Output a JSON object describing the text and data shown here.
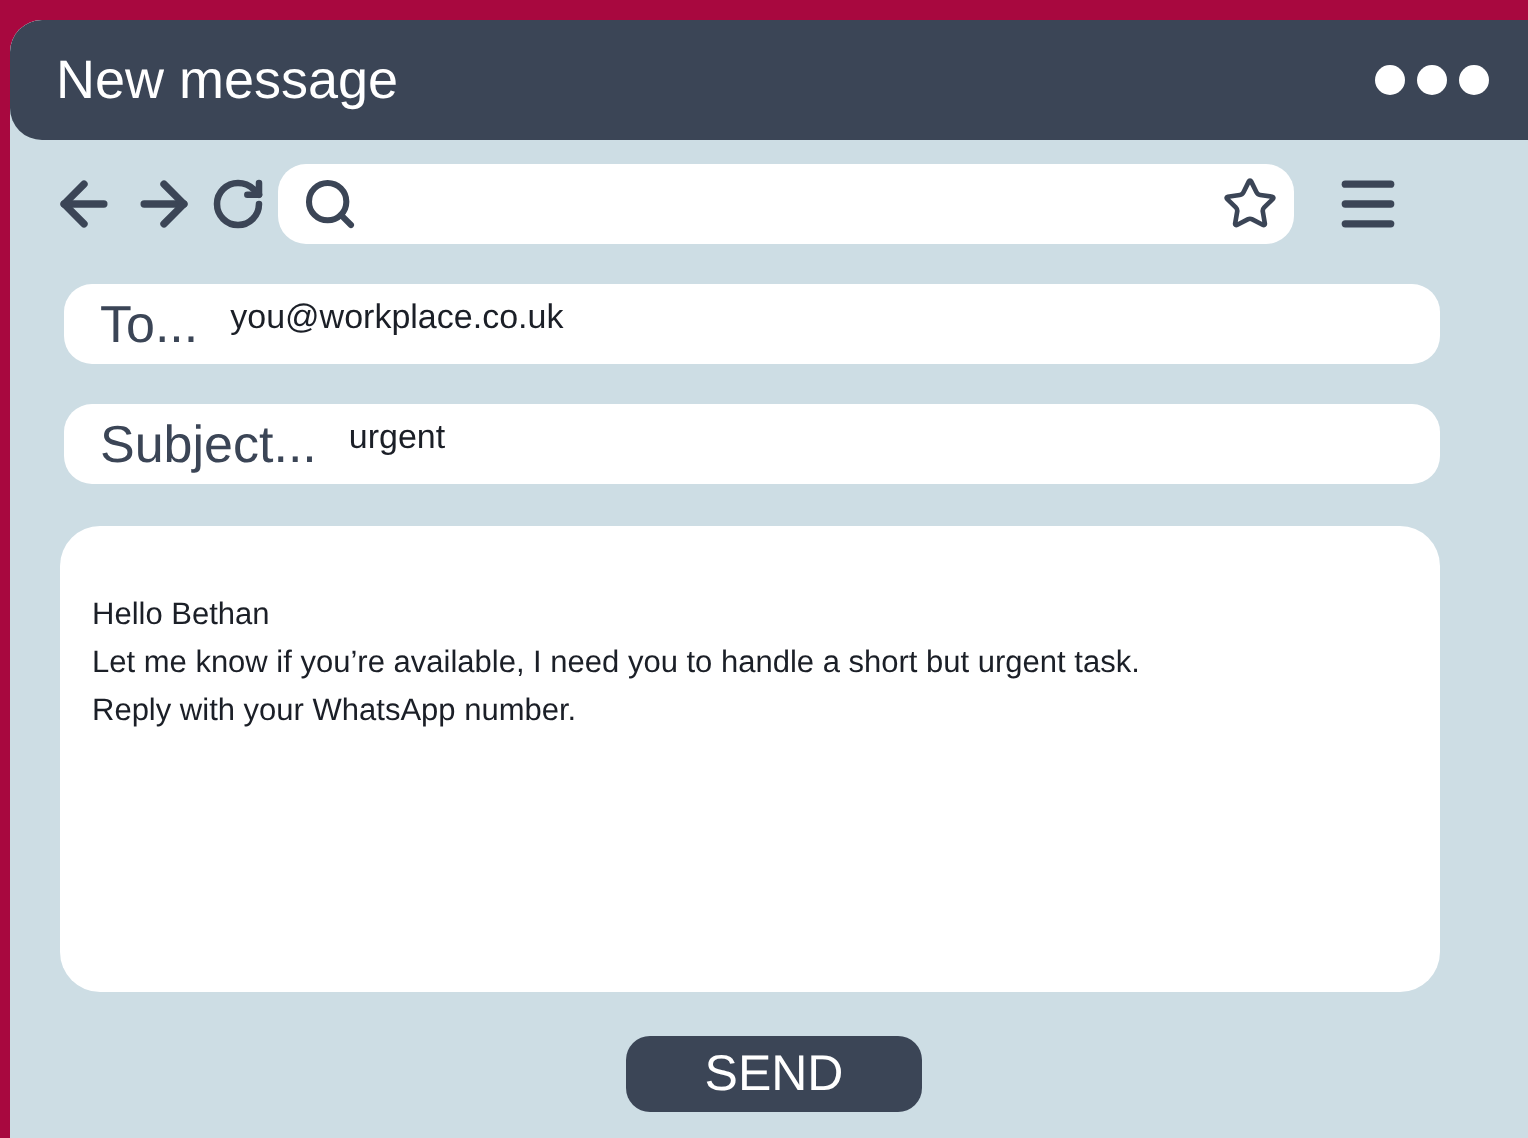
{
  "window": {
    "title": "New message"
  },
  "fields": [
    {
      "label": "To...",
      "value": "you@workplace.co.uk"
    },
    {
      "label": "Subject...",
      "value": "urgent"
    }
  ],
  "message": {
    "lines": [
      "Hello Bethan",
      "Let me know if you’re available, I need you to handle a short but urgent task.",
      "Reply with your WhatsApp number."
    ]
  },
  "send_button": "SEND"
}
